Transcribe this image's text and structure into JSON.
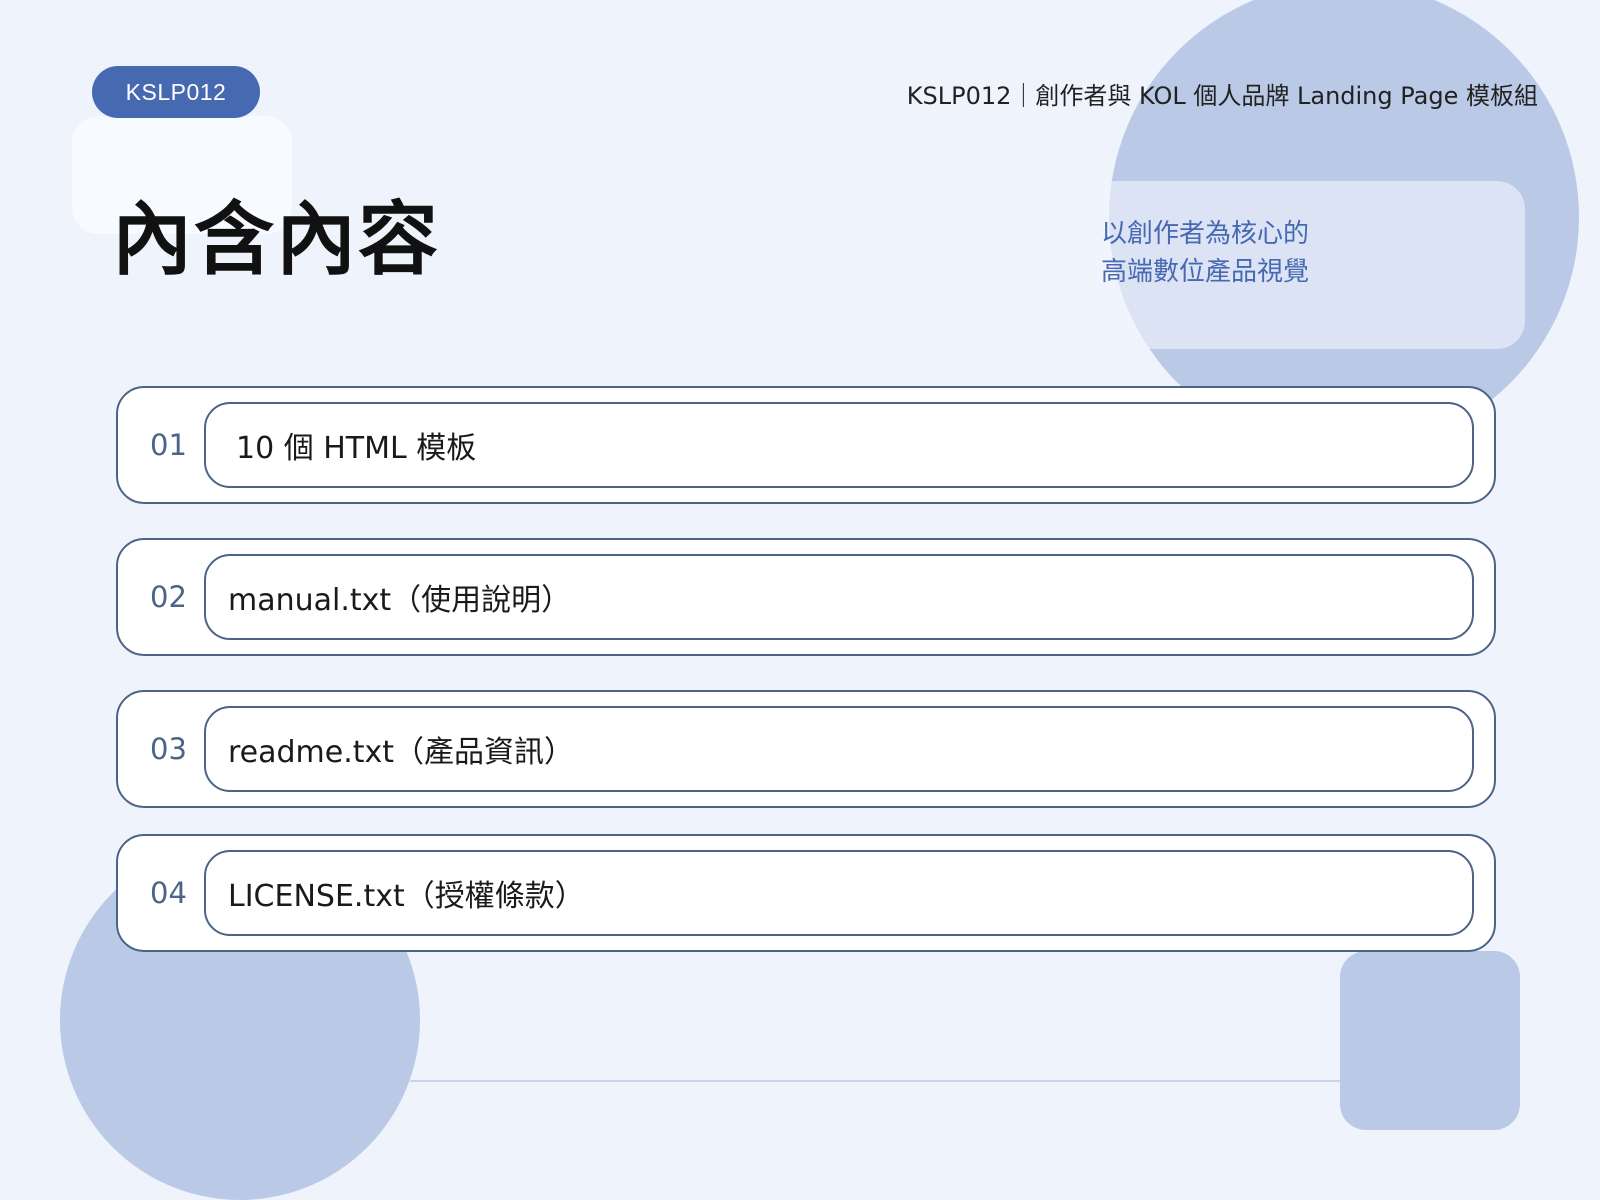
{
  "header": {
    "tag": "KSLP012",
    "title": "KSLP012｜創作者與 KOL 個人品牌 Landing Page 模板組"
  },
  "page_title": "內含內容",
  "tagline": {
    "line1": "以創作者為核心的",
    "line2": "高端數位產品視覺"
  },
  "items": [
    {
      "num": "01",
      "text": "10 個 HTML 模板"
    },
    {
      "num": "02",
      "text": "manual.txt（使用說明）"
    },
    {
      "num": "03",
      "text": "readme.txt（產品資訊）"
    },
    {
      "num": "04",
      "text": "LICENSE.txt（授權條款）"
    }
  ],
  "colors": {
    "background": "#eef3fc",
    "accent": "#4769b2",
    "shape": "#b9c9e6",
    "border": "#4b6487"
  }
}
